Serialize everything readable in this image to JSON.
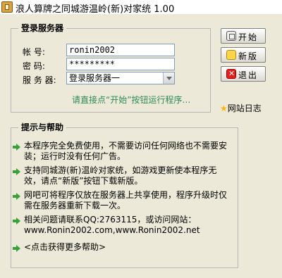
{
  "window": {
    "title": "浪人算牌之同城游温岭(新)对家统 1.00"
  },
  "login_group": {
    "title": "登录服务器",
    "account_label": "帐    号:",
    "account_value": "ronin2002",
    "password_label": "密    码:",
    "password_value": "*********",
    "server_label": "服 务 器:",
    "server_selected": "登录服务器一",
    "hint": "请直接点“开始”按钮运行程序…"
  },
  "buttons": {
    "start": "开始",
    "new": "新版",
    "exit": "退出"
  },
  "sidebar": {
    "weblog": "网站日志"
  },
  "help_group": {
    "title": "提示与帮助",
    "items": [
      "本程序完全免费使用，不需要访问任何网络也不需要安装；运行时没有任何广告。",
      "支持同城游(新)温岭对家统，如游戏更新使本程序无效，请点“新版”按钮下载新版。",
      "网吧可将程序仅放在服务器上共享使用，程序升级时仅需在服务器重新下载一次。",
      "相关问题请联系QQ:2763115，或访问网站：www.Ronin2002.com,www.Ronin2002.net",
      "<点击获得更多帮助>"
    ]
  }
}
